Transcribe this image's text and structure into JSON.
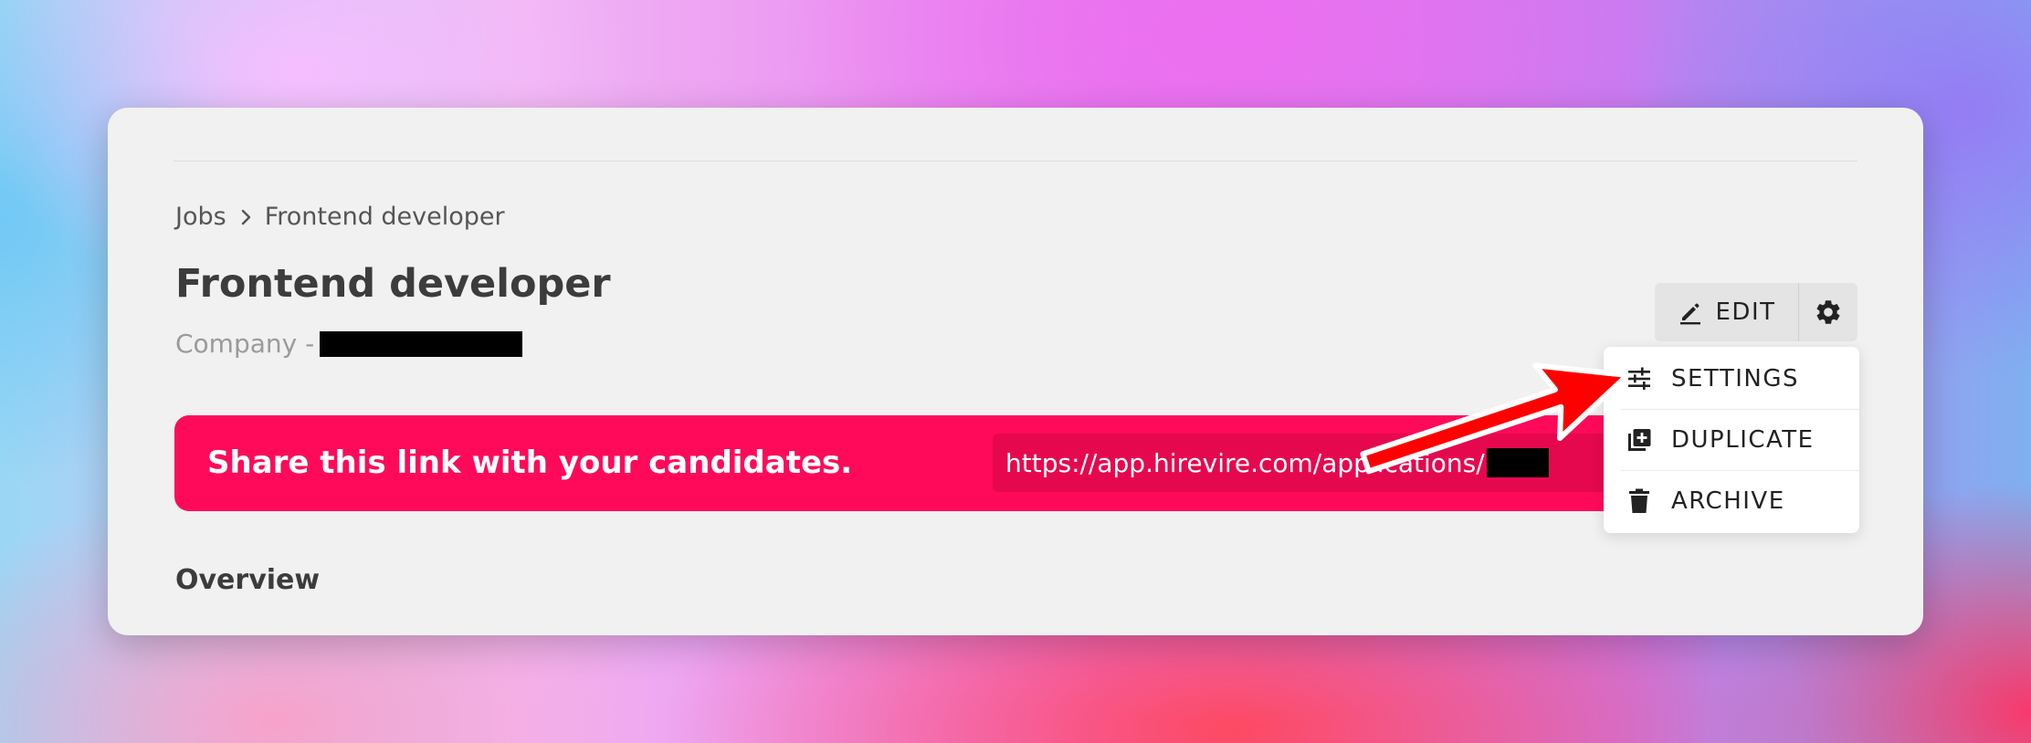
{
  "breadcrumb": {
    "items": [
      "Jobs",
      "Frontend developer"
    ]
  },
  "page": {
    "title": "Frontend developer",
    "company_label": "Company -"
  },
  "share": {
    "text": "Share this link with your candidates.",
    "link": "https://app.hirevire.com/applications/"
  },
  "section": {
    "overview": "Overview"
  },
  "toolbar": {
    "edit_label": "EDIT"
  },
  "menu": {
    "items": [
      {
        "label": "SETTINGS",
        "icon": "sliders-icon"
      },
      {
        "label": "DUPLICATE",
        "icon": "duplicate-icon"
      },
      {
        "label": "ARCHIVE",
        "icon": "trash-icon"
      }
    ]
  },
  "colors": {
    "brand": "#ff0a5a",
    "card_bg": "#f1f1f1",
    "arrow": "#ff0000"
  }
}
